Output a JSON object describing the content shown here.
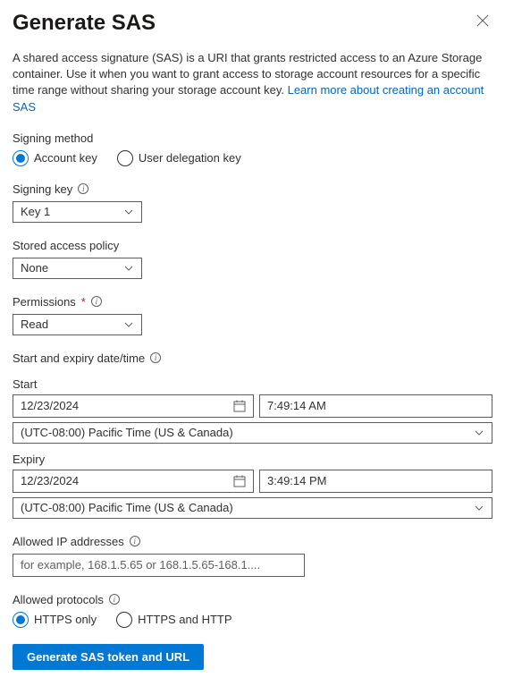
{
  "header": {
    "title": "Generate SAS"
  },
  "description": {
    "text": "A shared access signature (SAS) is a URI that grants restricted access to an Azure Storage container. Use it when you want to grant access to storage account resources for a specific time range without sharing your storage account key. ",
    "link_text": "Learn more about creating an account SAS"
  },
  "signing_method": {
    "label": "Signing method",
    "options": {
      "account_key": "Account key",
      "user_delegation": "User delegation key"
    }
  },
  "signing_key": {
    "label": "Signing key",
    "value": "Key 1"
  },
  "stored_policy": {
    "label": "Stored access policy",
    "value": "None"
  },
  "permissions": {
    "label": "Permissions",
    "value": "Read"
  },
  "datetime_section": {
    "label": "Start and expiry date/time",
    "start_label": "Start",
    "start_date": "12/23/2024",
    "start_time": "7:49:14 AM",
    "start_tz": "(UTC-08:00) Pacific Time (US & Canada)",
    "expiry_label": "Expiry",
    "expiry_date": "12/23/2024",
    "expiry_time": "3:49:14 PM",
    "expiry_tz": "(UTC-08:00) Pacific Time (US & Canada)"
  },
  "allowed_ips": {
    "label": "Allowed IP addresses",
    "placeholder": "for example, 168.1.5.65 or 168.1.5.65-168.1....",
    "value": ""
  },
  "allowed_protocols": {
    "label": "Allowed protocols",
    "options": {
      "https_only": "HTTPS only",
      "https_http": "HTTPS and HTTP"
    }
  },
  "actions": {
    "generate": "Generate SAS token and URL"
  }
}
